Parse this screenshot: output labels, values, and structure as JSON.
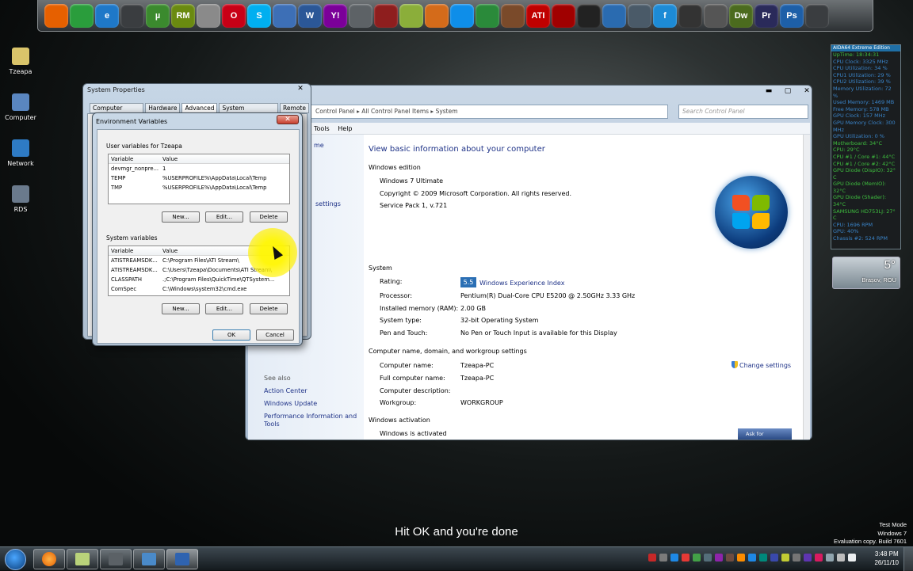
{
  "dock": {
    "icons": [
      {
        "name": "firefox-icon",
        "c": "#e66000",
        "t": ""
      },
      {
        "name": "chrome-icon",
        "c": "#2a9d3c",
        "t": ""
      },
      {
        "name": "internet-explorer-icon",
        "c": "#1e78c8",
        "t": "e"
      },
      {
        "name": "winamp-icon",
        "c": "#3a3d40",
        "t": ""
      },
      {
        "name": "utorrent-icon",
        "c": "#3b8a2e",
        "t": "µ"
      },
      {
        "name": "rm-icon",
        "c": "#6a8a10",
        "t": "RM"
      },
      {
        "name": "spider-web-icon",
        "c": "#8a8a8a",
        "t": ""
      },
      {
        "name": "opera-icon",
        "c": "#c80016",
        "t": "O"
      },
      {
        "name": "skype-icon",
        "c": "#00aff0",
        "t": "S"
      },
      {
        "name": "notepad-icon",
        "c": "#3d6fb6",
        "t": ""
      },
      {
        "name": "word-icon",
        "c": "#2b5797",
        "t": "W"
      },
      {
        "name": "yahoo-messenger-icon",
        "c": "#7b0099",
        "t": "Y!"
      },
      {
        "name": "gear-icon",
        "c": "#5d6266",
        "t": ""
      },
      {
        "name": "script-icon",
        "c": "#8e1e1e",
        "t": ""
      },
      {
        "name": "envelope-icon",
        "c": "#8bae3a",
        "t": ""
      },
      {
        "name": "cube-icon",
        "c": "#d46b1a",
        "t": ""
      },
      {
        "name": "teamviewer-icon",
        "c": "#0e8ee9",
        "t": ""
      },
      {
        "name": "vlc-icon",
        "c": "#2a8a3a",
        "t": ""
      },
      {
        "name": "coffee-icon",
        "c": "#7a4a2a",
        "t": ""
      },
      {
        "name": "ati-icon",
        "c": "#c00000",
        "t": "ATI"
      },
      {
        "name": "ati-catalyst-icon",
        "c": "#a00000",
        "t": ""
      },
      {
        "name": "blackberry-icon",
        "c": "#222",
        "t": ""
      },
      {
        "name": "network-icon",
        "c": "#2a6bb0",
        "t": ""
      },
      {
        "name": "transfer-icon",
        "c": "#4a5a68",
        "t": ""
      },
      {
        "name": "fancy-f-icon",
        "c": "#1d8bd6",
        "t": "f"
      },
      {
        "name": "steam-icon",
        "c": "#333",
        "t": ""
      },
      {
        "name": "alien-icon",
        "c": "#555",
        "t": ""
      },
      {
        "name": "dreamweaver-icon",
        "c": "#4b6b1e",
        "t": "Dw"
      },
      {
        "name": "premiere-icon",
        "c": "#2a2a5a",
        "t": "Pr"
      },
      {
        "name": "photoshop-icon",
        "c": "#1d5fa8",
        "t": "Ps"
      },
      {
        "name": "recycle-bin-icon",
        "c": "#3a3d40",
        "t": ""
      }
    ]
  },
  "desktop": {
    "icons": [
      {
        "label": "Tzeapa",
        "c": "#d9c46a"
      },
      {
        "label": "Computer",
        "c": "#5a86c0"
      },
      {
        "label": "Network",
        "c": "#2e7bc4"
      },
      {
        "label": "RDS",
        "c": "#6a7a8c"
      }
    ]
  },
  "aida": {
    "title": "AIDA64 Extreme Edition",
    "lines": [
      {
        "t": "UpTime: 18:34:31",
        "c": "g"
      },
      {
        "t": "CPU Clock: 3325 MHz",
        "c": "b"
      },
      {
        "t": "CPU Utilization: 34 %",
        "c": "b"
      },
      {
        "t": "CPU1 Utilization: 29 %",
        "c": "b"
      },
      {
        "t": "CPU2 Utilization: 39 %",
        "c": "b"
      },
      {
        "t": "Memory Utilization: 72",
        "c": "b"
      },
      {
        "t": "%",
        "c": "b"
      },
      {
        "t": "Used Memory: 1469 MB",
        "c": "b"
      },
      {
        "t": "Free Memory: 578 MB",
        "c": "b"
      },
      {
        "t": "GPU Clock: 157 MHz",
        "c": "b"
      },
      {
        "t": "GPU Memory Clock: 300",
        "c": "b"
      },
      {
        "t": "MHz",
        "c": "b"
      },
      {
        "t": "GPU Utilization: 0 %",
        "c": "b"
      },
      {
        "t": "Motherboard: 34°C",
        "c": "g"
      },
      {
        "t": "CPU: 29°C",
        "c": "g"
      },
      {
        "t": "CPU #1 / Core #1: 44°C",
        "c": "g"
      },
      {
        "t": "CPU #1 / Core #2: 42°C",
        "c": "g"
      },
      {
        "t": "GPU Diode (DispIO): 32°",
        "c": "g"
      },
      {
        "t": "C",
        "c": "g"
      },
      {
        "t": "GPU Diode (MemIO):",
        "c": "g"
      },
      {
        "t": "32°C",
        "c": "g"
      },
      {
        "t": "GPU Diode (Shader):",
        "c": "g"
      },
      {
        "t": "34°C",
        "c": "g"
      },
      {
        "t": "SAMSUNG HD753LJ: 27°",
        "c": "g"
      },
      {
        "t": "C",
        "c": "g"
      },
      {
        "t": "CPU: 1696 RPM",
        "c": "b"
      },
      {
        "t": "GPU: 40%",
        "c": "b"
      },
      {
        "t": "Chassis #2: 524 RPM",
        "c": "b"
      }
    ]
  },
  "weather": {
    "temp": "5°",
    "place": "Brașov, ROU"
  },
  "cp": {
    "address": "Control Panel  ▸  All Control Panel Items  ▸  System",
    "search": "Search Control Panel",
    "menu": [
      "Tools",
      "Help"
    ],
    "nav": {
      "home": "me",
      "settings": "settings",
      "see_also": "See also",
      "links": [
        "Action Center",
        "Windows Update",
        "Performance Information and",
        "Tools"
      ]
    },
    "title": "View basic information about your computer",
    "edition_header": "Windows edition",
    "edition": "Windows 7 Ultimate",
    "copyright": "Copyright © 2009 Microsoft Corporation.  All rights reserved.",
    "sp": "Service Pack 1, v.721",
    "system_header": "System",
    "rating_label": "Rating:",
    "rating_score": "5.5",
    "rating_link": "Windows Experience Index",
    "rows": [
      {
        "k": "Processor:",
        "v": "Pentium(R) Dual-Core  CPU     E5200  @ 2.50GHz   3.33 GHz"
      },
      {
        "k": "Installed memory (RAM):",
        "v": "2.00 GB"
      },
      {
        "k": "System type:",
        "v": "32-bit Operating System"
      },
      {
        "k": "Pen and Touch:",
        "v": "No Pen or Touch Input is available for this Display"
      }
    ],
    "name_header": "Computer name, domain, and workgroup settings",
    "name_rows": [
      {
        "k": "Computer name:",
        "v": "Tzeapa-PC"
      },
      {
        "k": "Full computer name:",
        "v": "Tzeapa-PC"
      },
      {
        "k": "Computer description:",
        "v": ""
      },
      {
        "k": "Workgroup:",
        "v": "WORKGROUP"
      }
    ],
    "change": "Change settings",
    "activation_header": "Windows activation",
    "activation": "Windows is activated",
    "ask": "Ask for"
  },
  "sysprops": {
    "title": "System Properties",
    "tabs": [
      "Computer Name",
      "Hardware",
      "Advanced",
      "System Protection",
      "Remote"
    ]
  },
  "env": {
    "title": "Environment Variables",
    "user_label": "User variables for Tzeapa",
    "col_var": "Variable",
    "col_val": "Value",
    "user_rows": [
      {
        "k": "devmgr_nonpre...",
        "v": "1"
      },
      {
        "k": "TEMP",
        "v": "%USERPROFILE%\\AppData\\Local\\Temp"
      },
      {
        "k": "TMP",
        "v": "%USERPROFILE%\\AppData\\Local\\Temp"
      }
    ],
    "sys_label": "System variables",
    "sys_rows": [
      {
        "k": "ATISTREAMSDK...",
        "v": "C:\\Program Files\\ATI Stream\\"
      },
      {
        "k": "ATISTREAMSDK...",
        "v": "C:\\Users\\Tzeapa\\Documents\\ATI Stream\\"
      },
      {
        "k": "CLASSPATH",
        "v": ".;C:\\Program Files\\QuickTime\\QTSystem..."
      },
      {
        "k": "ComSpec",
        "v": "C:\\Windows\\system32\\cmd.exe"
      }
    ],
    "new": "New...",
    "edit": "Edit...",
    "delete": "Delete",
    "ok": "OK",
    "cancel": "Cancel"
  },
  "subtitle": "Hit OK and you're done",
  "watermark": [
    "Test Mode",
    "Windows 7",
    "Evaluation copy. Build 7601"
  ],
  "taskbar": {
    "time": "3:48 PM",
    "date": "26/11/10"
  }
}
